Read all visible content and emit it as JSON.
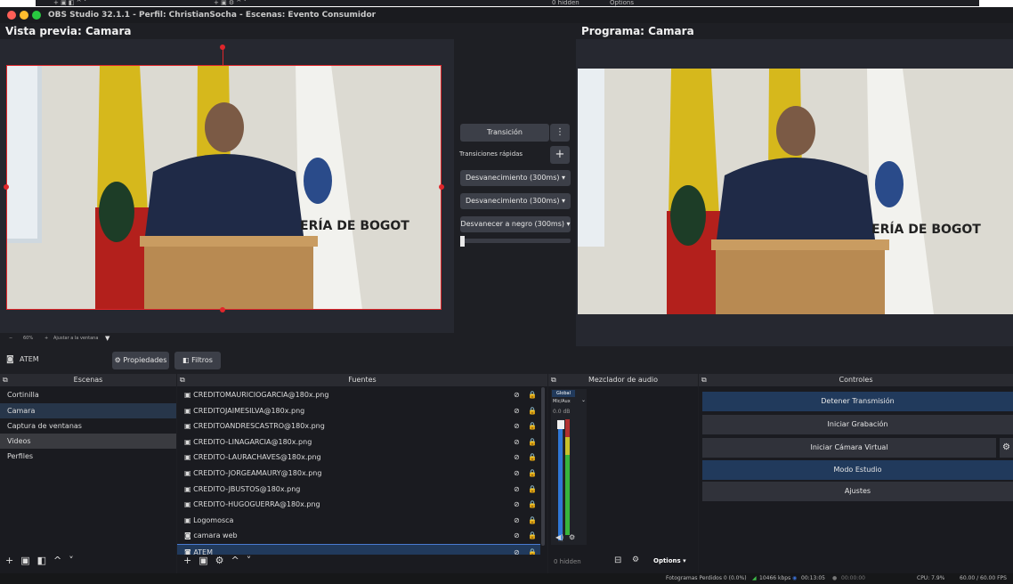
{
  "window": {
    "title": "OBS Studio 32.1.1 - Perfil: ChristianSocha - Escenas: Evento Consumidor",
    "top_strip_hidden": "0 hidden",
    "top_strip_options": "Options"
  },
  "preview": {
    "label": "Vista previa: Camara",
    "zoom": "60%",
    "fit": "Ajustar a la ventana"
  },
  "program": {
    "label": "Programa: Camara"
  },
  "transition": {
    "button": "Transición",
    "quick_label": "Transiciones rápidas",
    "items": [
      "Desvanecimiento (300ms)",
      "Desvanecimiento (300ms)",
      "Desvanecer a negro (300ms)"
    ],
    "tbar_value": 0
  },
  "source_bar": {
    "source": "ATEM",
    "properties": "Propiedades",
    "filters": "Filtros"
  },
  "scenes": {
    "title": "Escenas",
    "items": [
      {
        "label": "Cortinilla",
        "state": "normal"
      },
      {
        "label": "Camara",
        "state": "selected"
      },
      {
        "label": "Captura de ventanas",
        "state": "normal"
      },
      {
        "label": "Videos",
        "state": "hover"
      },
      {
        "label": "Perfiles",
        "state": "normal"
      }
    ]
  },
  "sources": {
    "title": "Fuentes",
    "items": [
      "CREDITOMAURICIOGARCIA@180x.png",
      "CREDITOJAIMESILVA@180x.png",
      "CREDITOANDRESCASTRO@180x.png",
      "CREDITO-LINAGARCIA@180x.png",
      "CREDITO-LAURACHAVES@180x.png",
      "CREDITO-JORGEAMAURY@180x.png",
      "CREDITO-JBUSTOS@180x.png",
      "CREDITO-HUGOGUERRA@180x.png",
      "Logomosca",
      "camara web",
      "ATEM"
    ]
  },
  "mixer": {
    "title": "Mezclador de audio",
    "global": "Global",
    "channel": "Mic/Aux",
    "level": "0.0 dB",
    "hidden": "0 hidden",
    "options": "Options"
  },
  "controls": {
    "title": "Controles",
    "buttons": [
      {
        "label": "Detener Transmisión",
        "active": true
      },
      {
        "label": "Iniciar Grabación",
        "active": false
      },
      {
        "label": "Iniciar Cámara Virtual",
        "active": false
      },
      {
        "label": "Modo Estudio",
        "active": true
      },
      {
        "label": "Ajustes",
        "active": false
      }
    ]
  },
  "status": {
    "dropped": "Fotogramas Perdidos 0 (0.0%)",
    "bitrate": "10466 kbps",
    "stream_time": "00:13:05",
    "rec_time": "00:00:00",
    "cpu": "CPU: 7.9%",
    "fps": "60.00 / 60.00 FPS"
  },
  "colors": {
    "accent": "#213a5c",
    "selection": "#27364a",
    "rec_red": "#e23b3b"
  }
}
